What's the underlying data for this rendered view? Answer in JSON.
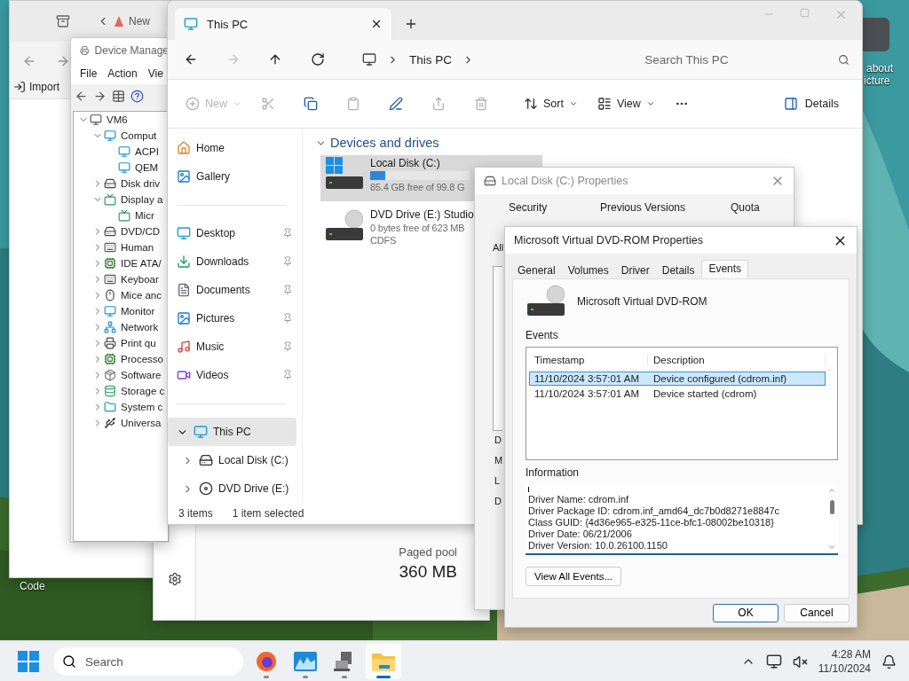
{
  "desktop": {
    "icons": [
      {
        "label": "Code"
      }
    ],
    "corner_icon": {
      "lines": [
        "about",
        "icture"
      ]
    }
  },
  "back_window": {
    "tab": "New",
    "import_button": "Import"
  },
  "task_manager": {
    "metric_label": "Paged pool",
    "metric_value": "360 MB"
  },
  "device_manager": {
    "title": "Device Manage",
    "menu": [
      "File",
      "Action",
      "Vie"
    ],
    "tree": [
      {
        "label": "VM6",
        "kind": "pc",
        "expanded": true,
        "children": [
          {
            "label": "Comput",
            "kind": "monitor",
            "expanded": true,
            "children": [
              {
                "label": "ACPI",
                "kind": "monitor"
              },
              {
                "label": "QEM",
                "kind": "monitor"
              }
            ]
          },
          {
            "label": "Disk driv",
            "kind": "drive",
            "expanded": false
          },
          {
            "label": "Display a",
            "kind": "display",
            "expanded": true,
            "children": [
              {
                "label": "Micr",
                "kind": "display"
              }
            ]
          },
          {
            "label": "DVD/CD",
            "kind": "drive",
            "expanded": false
          },
          {
            "label": "Human",
            "kind": "keyboard",
            "expanded": false
          },
          {
            "label": "IDE ATA/",
            "kind": "chip",
            "expanded": false
          },
          {
            "label": "Keyboar",
            "kind": "keyboard",
            "expanded": false
          },
          {
            "label": "Mice anc",
            "kind": "mouse",
            "expanded": false
          },
          {
            "label": "Monitor",
            "kind": "monitor",
            "expanded": false
          },
          {
            "label": "Network",
            "kind": "network",
            "expanded": false
          },
          {
            "label": "Print qu",
            "kind": "printer",
            "expanded": false
          },
          {
            "label": "Processo",
            "kind": "chip",
            "expanded": false
          },
          {
            "label": "Software",
            "kind": "box",
            "expanded": false
          },
          {
            "label": "Storage c",
            "kind": "storage",
            "expanded": false
          },
          {
            "label": "System c",
            "kind": "folder",
            "expanded": false
          },
          {
            "label": "Universa",
            "kind": "usb",
            "expanded": false
          }
        ]
      }
    ]
  },
  "explorer": {
    "tab": "This PC",
    "nav": [
      {
        "kind": "back",
        "disabled": false
      },
      {
        "kind": "forward",
        "disabled": true
      },
      {
        "kind": "up",
        "disabled": false
      },
      {
        "kind": "refresh",
        "disabled": false
      }
    ],
    "breadcrumb": [
      "This PC"
    ],
    "search": {
      "placeholder": "Search This PC"
    },
    "toolbar": [
      {
        "kind": "new",
        "label": "New",
        "disabled": true
      },
      {
        "kind": "cut",
        "disabled": true
      },
      {
        "kind": "copy",
        "disabled": false
      },
      {
        "kind": "paste",
        "disabled": true
      },
      {
        "kind": "rename",
        "disabled": false
      },
      {
        "kind": "share",
        "disabled": true
      },
      {
        "kind": "delete",
        "disabled": true
      },
      {
        "kind": "sort",
        "label": "Sort",
        "disabled": false
      },
      {
        "kind": "view",
        "label": "View",
        "disabled": false
      },
      {
        "kind": "more",
        "disabled": false
      }
    ],
    "details_button": "Details",
    "sidebar": [
      {
        "kind": "home",
        "label": "Home",
        "pinned": false,
        "selected": false
      },
      {
        "kind": "gallery",
        "label": "Gallery",
        "pinned": false,
        "selected": false
      },
      {
        "kind": "divider"
      },
      {
        "kind": "desktop",
        "label": "Desktop",
        "pinned": true,
        "selected": false
      },
      {
        "kind": "downloads",
        "label": "Downloads",
        "pinned": true,
        "selected": false
      },
      {
        "kind": "documents",
        "label": "Documents",
        "pinned": true,
        "selected": false
      },
      {
        "kind": "pictures",
        "label": "Pictures",
        "pinned": true,
        "selected": false
      },
      {
        "kind": "music",
        "label": "Music",
        "pinned": true,
        "selected": false
      },
      {
        "kind": "videos",
        "label": "Videos",
        "pinned": true,
        "selected": false
      },
      {
        "kind": "divider"
      },
      {
        "kind": "pc",
        "label": "This PC",
        "pinned": false,
        "selected": true,
        "expanded": true,
        "children": [
          {
            "kind": "disk",
            "label": "Local Disk (C:)",
            "pinned": false,
            "selected": false,
            "expanded": false
          },
          {
            "kind": "dvd",
            "label": "DVD Drive (E:)",
            "pinned": false,
            "selected": false,
            "expanded": false
          }
        ]
      }
    ],
    "section": "Devices and drives",
    "drives": [
      {
        "kind": "disk",
        "name": "Local Disk (C:)",
        "level": 0.15,
        "lines": [
          "85.4 GB free of 99.8 G"
        ],
        "selected": true
      },
      {
        "kind": "dvd",
        "name": "DVD Drive (E:) Studio",
        "lines": [
          "0 bytes free of 623 MB",
          "CDFS"
        ],
        "selected": false
      }
    ],
    "status": [
      "3 items",
      "1 item selected"
    ]
  },
  "disk_properties": {
    "title": "Local Disk (C:) Properties",
    "tabs": [
      "Security",
      "Previous Versions",
      "Quota"
    ],
    "label": "All",
    "letters": [
      "D",
      "M",
      "L",
      "D"
    ]
  },
  "dvd_properties": {
    "title": "Microsoft Virtual DVD-ROM Properties",
    "tabs": [
      {
        "label": "General",
        "selected": false
      },
      {
        "label": "Volumes",
        "selected": false
      },
      {
        "label": "Driver",
        "selected": false
      },
      {
        "label": "Details",
        "selected": false
      },
      {
        "label": "Events",
        "selected": true
      }
    ],
    "device_name": "Microsoft Virtual DVD-ROM",
    "events_label": "Events",
    "columns": [
      "Timestamp",
      "Description"
    ],
    "rows": [
      {
        "cells": [
          "11/10/2024 3:57:01 AM",
          "Device configured (cdrom.inf)"
        ],
        "selected": true
      },
      {
        "cells": [
          "11/10/2024 3:57:01 AM",
          "Device started (cdrom)"
        ],
        "selected": false
      }
    ],
    "information_label": "Information",
    "information": [
      "Driver Name: cdrom.inf",
      "Driver Package ID: cdrom.inf_amd64_dc7b0d8271e8847c",
      "Class GUID: {4d36e965-e325-11ce-bfc1-08002be10318}",
      "Driver Date: 06/21/2006",
      "Driver Version: 10.0.26100.1150"
    ],
    "view_all_button": "View All Events...",
    "buttons": [
      "OK",
      "Cancel"
    ]
  },
  "taskbar": {
    "search_placeholder": "Search",
    "apps": [
      {
        "kind": "browser",
        "active": false
      },
      {
        "kind": "monitor",
        "active": false
      },
      {
        "kind": "devices",
        "active": false
      },
      {
        "kind": "folder",
        "active": true
      }
    ],
    "time": "4:28 AM",
    "date": "11/10/2024"
  }
}
